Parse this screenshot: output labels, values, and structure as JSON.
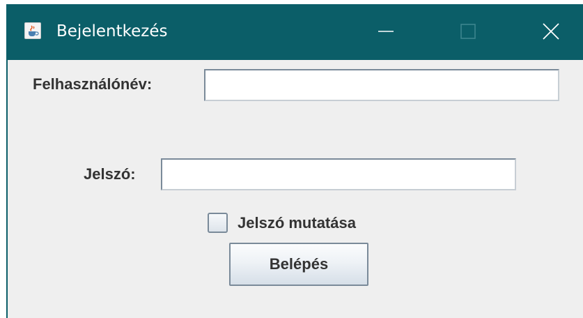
{
  "window": {
    "title": "Bejelentkezés"
  },
  "form": {
    "username_label": "Felhasználónév:",
    "username_value": "",
    "password_label": "Jelszó:",
    "password_value": "",
    "show_password_label": "Jelszó mutatása",
    "show_password_checked": false,
    "login_button_label": "Belépés"
  },
  "icons": {
    "app": "java-cup-icon",
    "minimize": "minimize-icon",
    "maximize": "maximize-icon",
    "close": "close-icon"
  },
  "colors": {
    "titlebar": "#0b5e68",
    "client_bg": "#efefef",
    "label_text": "#333333"
  }
}
